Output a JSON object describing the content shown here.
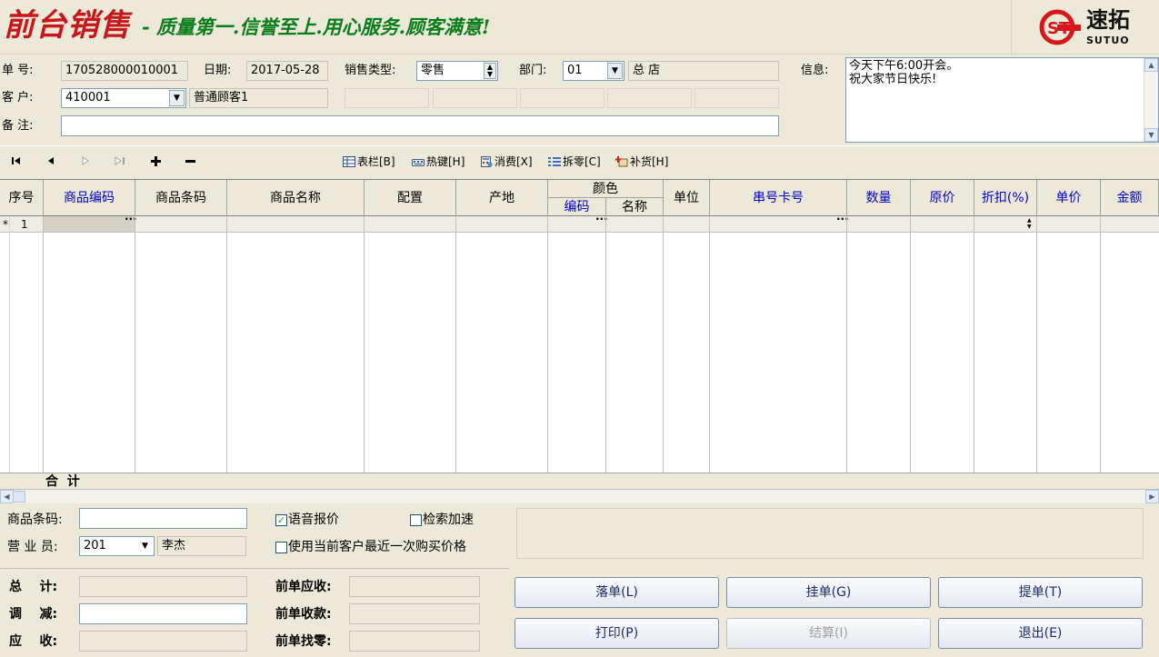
{
  "header": {
    "title": "前台销售",
    "slogan": "- 质量第一.信誉至上.用心服务.顾客满意!",
    "logo_cn": "速拓",
    "logo_en": "SUTUO"
  },
  "form": {
    "order_no_label": "单  号:",
    "order_no": "170528000010001",
    "date_label": "日期:",
    "date": "2017-05-28",
    "sale_type_label": "销售类型:",
    "sale_type": "零售",
    "dept_label": "部门:",
    "dept_code": "01",
    "dept_name": "总  店",
    "info_label": "信息:",
    "info_text_1": "今天下午6:00开会。",
    "info_text_2": "祝大家节日快乐!",
    "customer_label": "客  户:",
    "customer_code": "410001",
    "customer_name": "普通顾客1",
    "remark_label": "备  注:",
    "remark": ""
  },
  "toolbar": {
    "columns": "表栏[B]",
    "hotkeys": "热键[H]",
    "consume": "消费[X]",
    "split": "拆零[C]",
    "restock": "补货[H]"
  },
  "grid": {
    "col_seq": "序号",
    "col_code": "商品编码",
    "col_barcode": "商品条码",
    "col_name": "商品名称",
    "col_config": "配置",
    "col_origin": "产地",
    "col_color": "颜色",
    "col_color_code": "编码",
    "col_color_name": "名称",
    "col_unit": "单位",
    "col_serial": "串号卡号",
    "col_qty": "数量",
    "col_orig_price": "原价",
    "col_discount": "折扣(%)",
    "col_price": "单价",
    "col_amount": "金额",
    "row_marker": "*",
    "row_seq": "1",
    "sum_label": "合  计"
  },
  "bottom": {
    "barcode_label": "商品条码:",
    "barcode_value": "",
    "voice_label": "语音报价",
    "voice_checked": true,
    "search_speed_label": "检索加速",
    "clerk_label": "营 业 员:",
    "clerk_code": "201",
    "clerk_name": "李杰",
    "last_price_label": "使用当前客户最近一次购买价格",
    "total_label": "总    计:",
    "adjust_label": "调    减:",
    "receivable_label": "应    收:",
    "prev_receivable_label": "前单应收:",
    "prev_received_label": "前单收款:",
    "prev_change_label": "前单找零:"
  },
  "buttons": {
    "place_order": "落单(L)",
    "hold_order": "挂单(G)",
    "pick_order": "提单(T)",
    "print": "打印(P)",
    "settle": "结算(I)",
    "exit": "退出(E)"
  },
  "colors": {
    "title_red": "#c8161d",
    "slogan_green": "#0a7d1a",
    "header_blue": "#0000cc",
    "panel_bg": "#ece9d8"
  }
}
